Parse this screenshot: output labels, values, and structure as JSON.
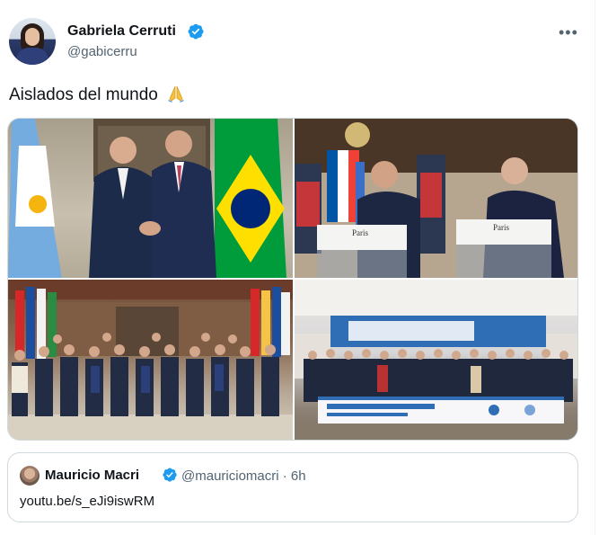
{
  "tweet": {
    "author": {
      "display_name": "Gabriela Cerruti",
      "handle": "@gabicerru",
      "verified": true
    },
    "more_icon": "more-horizontal-icon",
    "text": "Aislados del mundo",
    "emoji": "folded-hands-emoji",
    "photos": [
      {
        "alt_semantic": "two-leaders-handshake-with-flags"
      },
      {
        "alt_semantic": "press-conference-paris",
        "sign_left": "Paris",
        "sign_right": "Paris"
      },
      {
        "alt_semantic": "group-photo-of-leaders-with-flags"
      },
      {
        "alt_semantic": "celac-summit-group-photo"
      }
    ]
  },
  "quote": {
    "display_name": "Mauricio Macri",
    "handle_time": "@mauriciomacri · 6h",
    "text": "youtu.be/s_eJi9iswRM",
    "verified": true
  },
  "colors": {
    "text_primary": "#0f1419",
    "text_secondary": "#536471",
    "verified_blue": "#1d9bf0",
    "border": "#cfd9de"
  }
}
